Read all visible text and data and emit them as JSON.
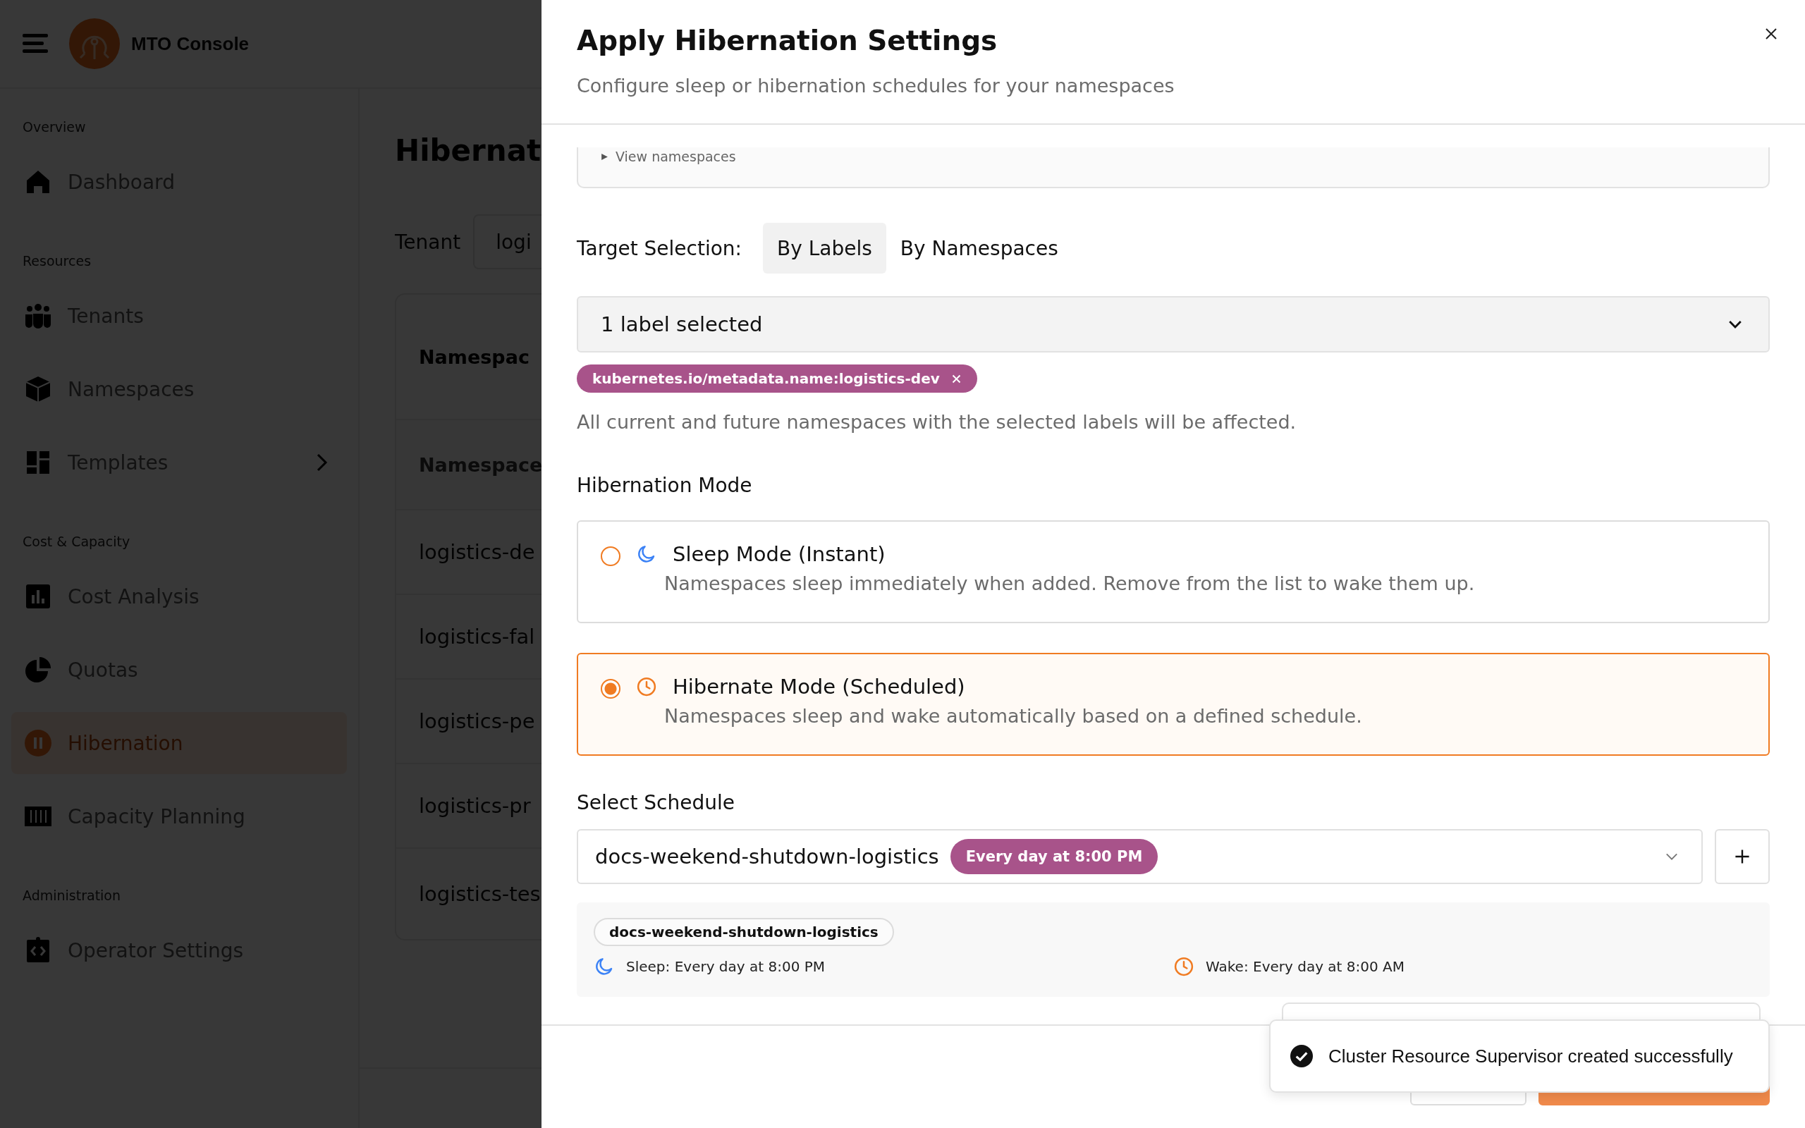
{
  "app": {
    "title": "MTO Console"
  },
  "sidebar": {
    "sections": [
      {
        "heading": "Overview",
        "items": [
          {
            "label": "Dashboard",
            "selected": false,
            "expandable": false
          }
        ]
      },
      {
        "heading": "Resources",
        "items": [
          {
            "label": "Tenants",
            "selected": false,
            "expandable": false
          },
          {
            "label": "Namespaces",
            "selected": false,
            "expandable": false
          },
          {
            "label": "Templates",
            "selected": false,
            "expandable": true
          }
        ]
      },
      {
        "heading": "Cost & Capacity",
        "items": [
          {
            "label": "Cost Analysis",
            "selected": false,
            "expandable": false
          },
          {
            "label": "Quotas",
            "selected": false,
            "expandable": false
          },
          {
            "label": "Hibernation",
            "selected": true,
            "expandable": false
          },
          {
            "label": "Capacity Planning",
            "selected": false,
            "expandable": false
          }
        ]
      },
      {
        "heading": "Administration",
        "items": [
          {
            "label": "Operator Settings",
            "selected": false,
            "expandable": false
          }
        ]
      }
    ]
  },
  "page": {
    "title": "Hibernat",
    "tenant_label": "Tenant",
    "tenant_value": "logi",
    "table": {
      "title": "Namespac",
      "column_1": "Namespace",
      "rows": [
        "logistics-de",
        "logistics-fal",
        "logistics-pe",
        "logistics-pr",
        "logistics-tes"
      ]
    }
  },
  "modal": {
    "title": "Apply Hibernation Settings",
    "subtitle": "Configure sleep or hibernation schedules for your namespaces",
    "details_toggle": "View namespaces",
    "target_selection": {
      "label": "Target Selection:",
      "tabs": [
        {
          "label": "By Labels",
          "selected": true
        },
        {
          "label": "By Namespaces",
          "selected": false
        }
      ]
    },
    "label_select": {
      "value": "1 label selected"
    },
    "selected_labels": [
      "kubernetes.io/metadata.name:logistics-dev"
    ],
    "helper_text": "All current and future namespaces with the selected labels will be affected.",
    "mode": {
      "heading": "Hibernation Mode",
      "options": [
        {
          "kind": "sleep",
          "title": "Sleep Mode (Instant)",
          "description": "Namespaces sleep immediately when added. Remove from the list to wake them up.",
          "selected": false
        },
        {
          "kind": "scheduled",
          "title": "Hibernate Mode (Scheduled)",
          "description": "Namespaces sleep and wake automatically based on a defined schedule.",
          "selected": true
        }
      ]
    },
    "schedule": {
      "heading": "Select Schedule",
      "value": "docs-weekend-shutdown-logistics",
      "badge": "Every day at 8:00 PM",
      "details": {
        "name": "docs-weekend-shutdown-logistics",
        "sleep": "Sleep: Every day at 8:00 PM",
        "wake": "Wake: Every day at 8:00 AM"
      }
    }
  },
  "toast": {
    "message": "Cluster Resource Supervisor created successfully"
  }
}
